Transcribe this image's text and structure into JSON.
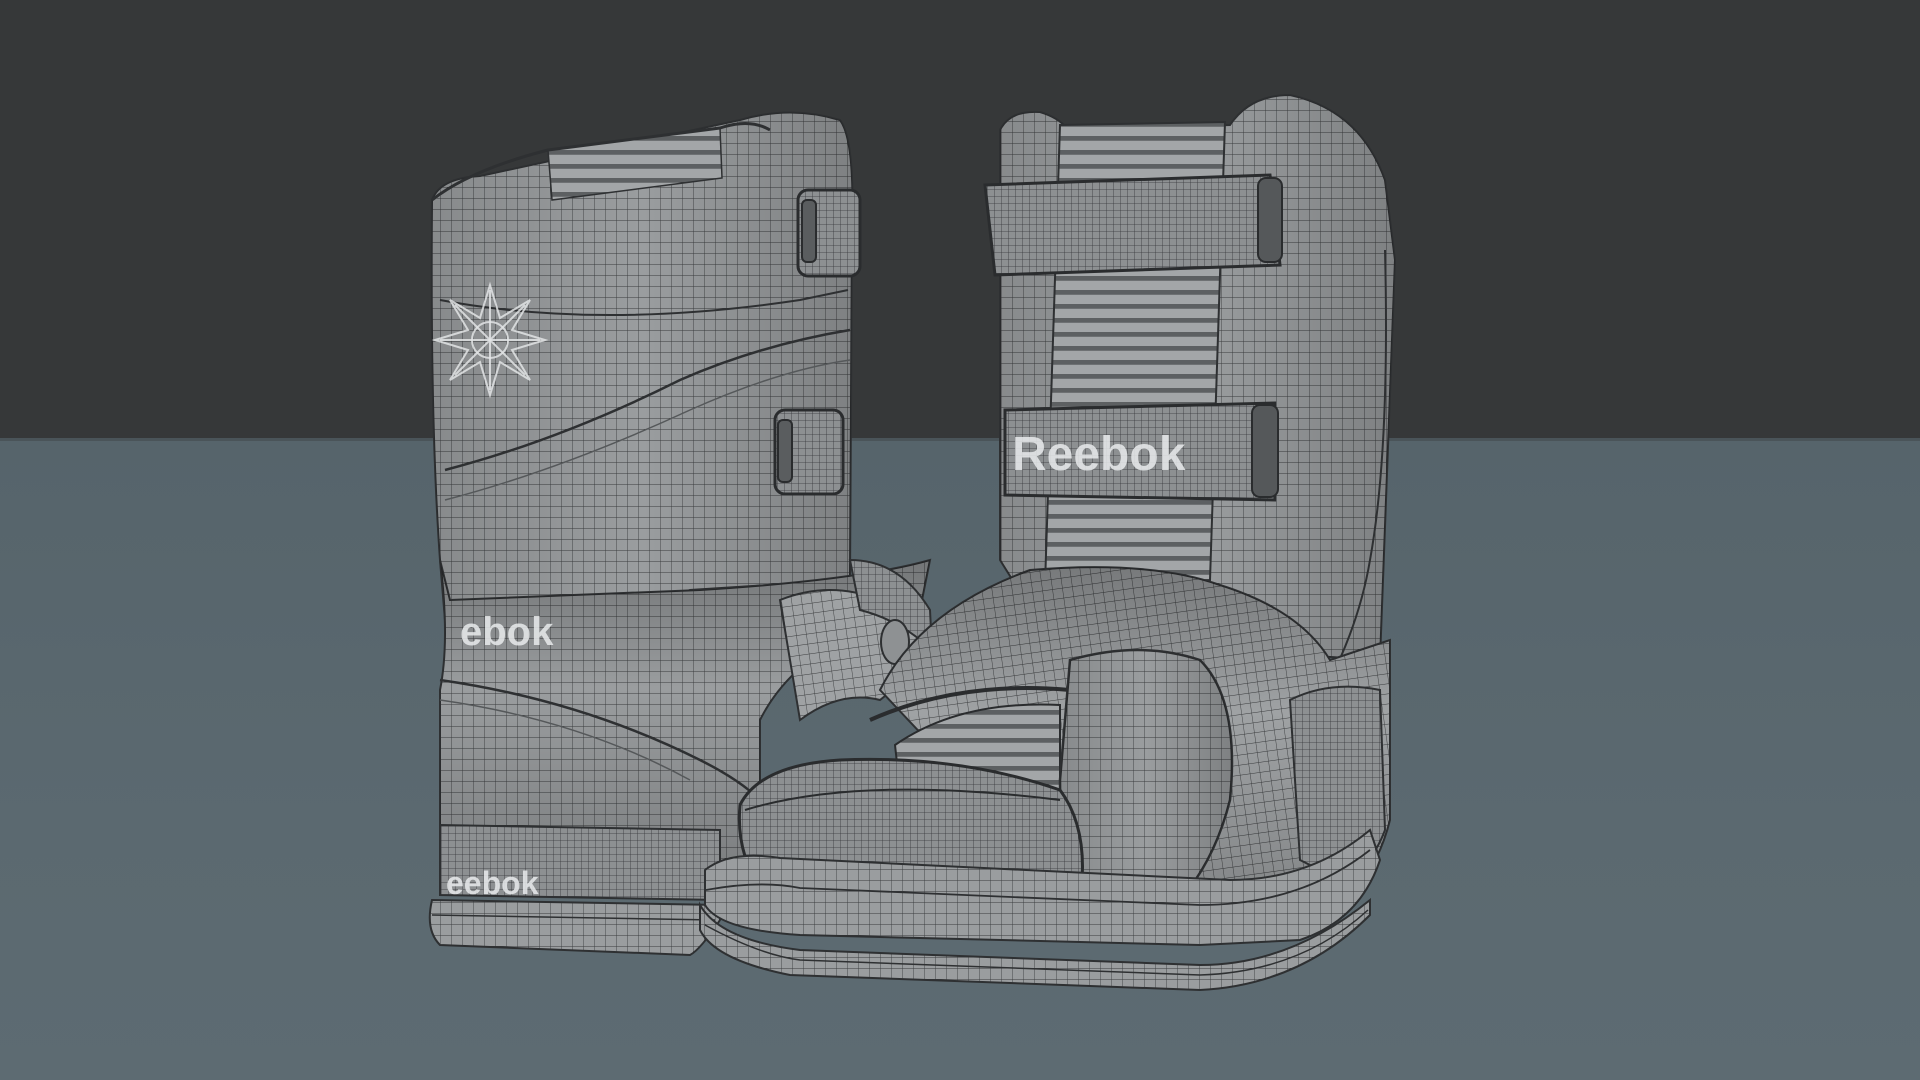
{
  "scene": {
    "backdrop_color": "#363839",
    "floor_color": "#58666d",
    "mesh_color": "#9a9d9f",
    "wire_color": "#3a3c3e"
  },
  "boots": {
    "left": {
      "shaft_logo_text": "ebok",
      "heel_logo_text": "eebok"
    },
    "right": {
      "strap_logo_text": "Reebok"
    }
  }
}
